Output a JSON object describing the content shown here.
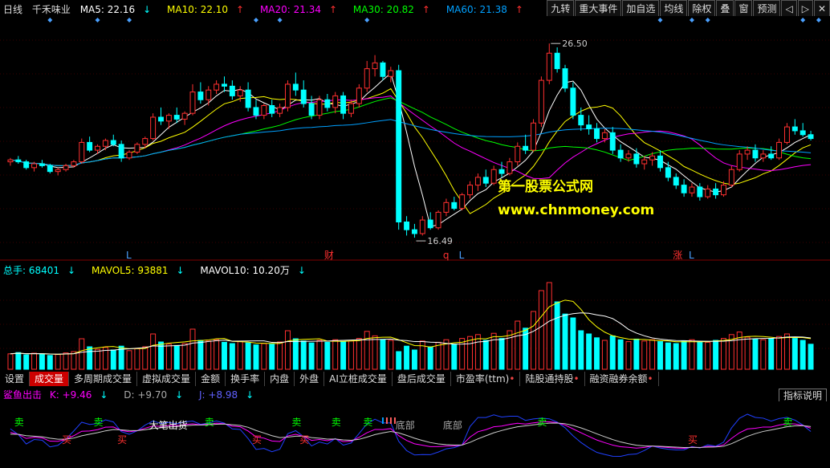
{
  "main_header": {
    "period": "日线",
    "stock_name": "千禾味业",
    "ma5": "MA5: 22.16",
    "ma10": "MA10: 22.10",
    "ma20": "MA20: 21.34",
    "ma30": "MA30: 20.82",
    "ma60": "MA60: 21.38",
    "arrow_down": "↓",
    "arrow_up": "↑"
  },
  "top_buttons": [
    "九转",
    "重大事件",
    "加自选",
    "均线",
    "除权",
    "叠",
    "窗",
    "预测"
  ],
  "colors": {
    "ma5": "#ffffff",
    "ma10": "#ffff00",
    "ma20": "#ff00ff",
    "ma30": "#00ff00",
    "ma60": "#00a0ff",
    "up": "#ff3030",
    "down": "#00ffff"
  },
  "price_chart": {
    "high_label": "26.50",
    "low_label": "16.49",
    "events": [
      "L",
      "财",
      "q",
      "L",
      "涨",
      "L"
    ]
  },
  "watermark": {
    "line1": "第一股票公式网",
    "line2": "www.chnmoney.com"
  },
  "volume_header": {
    "total": "总手: 68401",
    "mavol5": "MAVOL5: 93881",
    "mavol10": "MAVOL10: 10.20万",
    "arrow_down": "↓"
  },
  "tabs": [
    "设置",
    "成交量",
    "多周期成交量",
    "虚拟成交量",
    "金额",
    "换手率",
    "内盘",
    "外盘",
    "AI立桩成交量",
    "盘后成交量",
    "市盈率(ttm)",
    "陆股通持股",
    "融资融券余额"
  ],
  "indicator": {
    "name": "鲨鱼出击",
    "k": "K: +9.46",
    "d": "D: +9.70",
    "j": "J: +8.98",
    "arrow_down": "↓",
    "help_button": "指标说明",
    "sell": "卖",
    "buy": "买",
    "pen_buy": "大笔出货",
    "bottom": "底部"
  },
  "chart_data": {
    "type": "candlestick",
    "title": "千禾味业 日线",
    "ylim": [
      15.5,
      27.5
    ],
    "ohlc": [
      [
        20.4,
        20.6,
        20.2,
        20.5
      ],
      [
        20.5,
        20.7,
        20.3,
        20.4
      ],
      [
        20.4,
        20.5,
        20.0,
        20.1
      ],
      [
        20.1,
        20.4,
        19.9,
        20.3
      ],
      [
        20.3,
        20.5,
        20.1,
        20.2
      ],
      [
        20.2,
        20.3,
        19.8,
        19.9
      ],
      [
        19.9,
        20.1,
        19.7,
        20.0
      ],
      [
        20.0,
        20.3,
        19.9,
        20.2
      ],
      [
        20.2,
        20.5,
        20.1,
        20.4
      ],
      [
        20.4,
        21.6,
        20.3,
        21.4
      ],
      [
        21.4,
        21.7,
        20.9,
        21.0
      ],
      [
        21.0,
        21.3,
        20.8,
        21.2
      ],
      [
        21.2,
        21.6,
        21.0,
        21.5
      ],
      [
        21.5,
        21.8,
        21.2,
        21.3
      ],
      [
        21.3,
        21.5,
        20.4,
        20.6
      ],
      [
        20.6,
        21.0,
        20.5,
        20.9
      ],
      [
        20.9,
        21.4,
        20.8,
        21.3
      ],
      [
        21.3,
        21.7,
        21.1,
        21.6
      ],
      [
        21.6,
        22.9,
        21.5,
        22.7
      ],
      [
        22.7,
        23.2,
        22.3,
        22.5
      ],
      [
        22.5,
        22.9,
        22.1,
        22.8
      ],
      [
        22.8,
        23.2,
        22.4,
        22.6
      ],
      [
        22.6,
        23.0,
        22.3,
        22.9
      ],
      [
        22.9,
        24.4,
        22.8,
        24.0
      ],
      [
        24.0,
        24.5,
        23.4,
        23.6
      ],
      [
        23.6,
        24.3,
        23.3,
        24.1
      ],
      [
        24.1,
        24.6,
        23.9,
        24.4
      ],
      [
        24.4,
        24.8,
        24.0,
        24.3
      ],
      [
        24.3,
        24.6,
        23.6,
        23.8
      ],
      [
        23.8,
        24.3,
        23.5,
        24.1
      ],
      [
        24.1,
        24.5,
        23.0,
        23.2
      ],
      [
        23.2,
        23.6,
        22.6,
        22.8
      ],
      [
        22.8,
        23.4,
        22.6,
        23.3
      ],
      [
        23.3,
        23.6,
        22.7,
        22.9
      ],
      [
        22.9,
        23.4,
        22.7,
        23.2
      ],
      [
        23.2,
        24.6,
        23.0,
        24.4
      ],
      [
        24.4,
        25.0,
        23.8,
        24.1
      ],
      [
        24.1,
        24.6,
        23.2,
        23.4
      ],
      [
        23.4,
        23.8,
        22.6,
        22.8
      ],
      [
        22.8,
        23.8,
        22.6,
        23.6
      ],
      [
        23.6,
        23.9,
        23.0,
        23.2
      ],
      [
        23.2,
        24.0,
        22.9,
        23.8
      ],
      [
        23.8,
        24.0,
        22.6,
        22.9
      ],
      [
        22.9,
        23.6,
        22.7,
        23.4
      ],
      [
        23.4,
        24.4,
        23.2,
        24.2
      ],
      [
        24.2,
        25.6,
        24.0,
        25.2
      ],
      [
        25.2,
        25.9,
        24.8,
        25.5
      ],
      [
        25.5,
        25.6,
        24.6,
        24.8
      ],
      [
        24.8,
        25.3,
        24.5,
        25.1
      ],
      [
        25.1,
        25.4,
        16.9,
        17.3
      ],
      [
        17.3,
        17.6,
        16.6,
        16.9
      ],
      [
        16.9,
        17.2,
        16.49,
        16.7
      ],
      [
        16.7,
        17.6,
        16.6,
        17.4
      ],
      [
        17.4,
        17.8,
        16.9,
        17.0
      ],
      [
        17.0,
        17.9,
        16.9,
        17.8
      ],
      [
        17.8,
        18.5,
        17.6,
        18.3
      ],
      [
        18.3,
        18.6,
        17.9,
        18.0
      ],
      [
        18.0,
        18.8,
        17.9,
        18.7
      ],
      [
        18.7,
        19.4,
        18.5,
        19.2
      ],
      [
        19.2,
        19.8,
        18.9,
        19.6
      ],
      [
        19.6,
        20.0,
        19.1,
        19.3
      ],
      [
        19.3,
        20.2,
        19.2,
        20.0
      ],
      [
        20.0,
        20.4,
        19.6,
        19.8
      ],
      [
        19.8,
        20.6,
        19.7,
        20.4
      ],
      [
        20.4,
        21.4,
        20.2,
        21.2
      ],
      [
        21.2,
        21.8,
        20.8,
        21.0
      ],
      [
        21.0,
        22.6,
        20.9,
        22.4
      ],
      [
        22.4,
        24.8,
        22.2,
        24.6
      ],
      [
        24.6,
        26.5,
        24.4,
        26.0
      ],
      [
        26.0,
        26.3,
        25.0,
        25.2
      ],
      [
        25.2,
        25.4,
        24.0,
        24.2
      ],
      [
        24.2,
        24.5,
        22.6,
        22.8
      ],
      [
        22.8,
        23.2,
        22.0,
        22.3
      ],
      [
        22.3,
        22.8,
        21.8,
        22.1
      ],
      [
        22.1,
        22.4,
        21.4,
        21.6
      ],
      [
        21.6,
        22.1,
        21.4,
        21.9
      ],
      [
        21.9,
        22.2,
        20.8,
        21.0
      ],
      [
        21.0,
        21.3,
        20.4,
        20.6
      ],
      [
        20.6,
        21.0,
        20.4,
        20.8
      ],
      [
        20.8,
        21.1,
        20.1,
        20.3
      ],
      [
        20.3,
        20.7,
        20.0,
        20.5
      ],
      [
        20.5,
        20.9,
        20.2,
        20.7
      ],
      [
        20.7,
        21.0,
        19.9,
        20.1
      ],
      [
        20.1,
        20.4,
        19.4,
        19.6
      ],
      [
        19.6,
        19.8,
        19.0,
        19.2
      ],
      [
        19.2,
        19.5,
        18.6,
        18.8
      ],
      [
        18.8,
        19.3,
        18.6,
        19.1
      ],
      [
        19.1,
        19.3,
        18.4,
        18.6
      ],
      [
        18.6,
        19.2,
        18.5,
        19.0
      ],
      [
        19.0,
        19.3,
        18.5,
        18.7
      ],
      [
        18.7,
        19.4,
        18.6,
        19.2
      ],
      [
        19.2,
        20.2,
        19.1,
        20.0
      ],
      [
        20.0,
        21.0,
        19.9,
        20.8
      ],
      [
        20.8,
        21.2,
        20.5,
        21.0
      ],
      [
        21.0,
        21.3,
        20.4,
        20.6
      ],
      [
        20.6,
        21.0,
        20.4,
        20.8
      ],
      [
        20.8,
        21.2,
        20.5,
        20.6
      ],
      [
        20.6,
        21.6,
        20.5,
        21.4
      ],
      [
        21.4,
        22.4,
        21.3,
        22.2
      ],
      [
        22.2,
        22.6,
        21.8,
        22.0
      ],
      [
        22.0,
        22.4,
        21.7,
        21.8
      ],
      [
        21.8,
        22.0,
        21.5,
        21.6
      ]
    ],
    "volume": [
      48,
      52,
      45,
      50,
      47,
      43,
      46,
      51,
      55,
      95,
      70,
      62,
      68,
      60,
      72,
      58,
      64,
      70,
      110,
      85,
      78,
      74,
      80,
      125,
      90,
      88,
      92,
      84,
      80,
      86,
      82,
      76,
      80,
      78,
      85,
      120,
      95,
      88,
      82,
      90,
      84,
      92,
      86,
      88,
      96,
      118,
      104,
      92,
      90,
      55,
      72,
      60,
      88,
      70,
      84,
      92,
      78,
      96,
      102,
      108,
      90,
      112,
      96,
      120,
      150,
      128,
      180,
      245,
      270,
      210,
      172,
      160,
      120,
      110,
      98,
      90,
      104,
      92,
      86,
      94,
      88,
      92,
      86,
      82,
      80,
      88,
      92,
      86,
      84,
      90,
      96,
      108,
      116,
      100,
      94,
      92,
      96,
      102,
      110,
      96,
      90,
      78
    ],
    "ylabel": ""
  }
}
